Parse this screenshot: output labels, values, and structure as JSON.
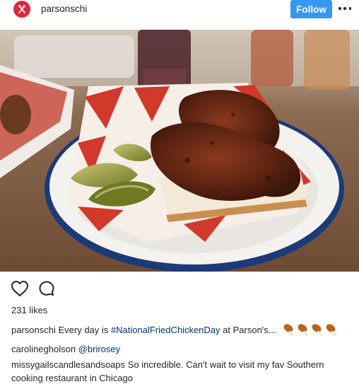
{
  "header": {
    "username": "parsonschi",
    "follow_label": "Follow",
    "avatar_icon": "fork-knife-icon",
    "more_icon": "more-options-icon"
  },
  "photo": {
    "icon": "fried-chicken-photo"
  },
  "actions": {
    "like_icon": "heart-icon",
    "comment_icon": "comment-bubble-icon"
  },
  "likes": "231 likes",
  "caption": {
    "username": "parsonschi",
    "text_before": " Every day is ",
    "hashtag": "#NationalFriedChickenDay",
    "text_after": " at Parson's...",
    "emoji_icon": "drumstick-icon"
  },
  "comments": [
    {
      "username": "carolinegholson",
      "mention": "@brirosey",
      "text": ""
    },
    {
      "username": "missygailscandlesandsoaps",
      "text": " So incredible. Can't wait to visit my fav Southern cooking restaurant in Chicago"
    }
  ],
  "colors": {
    "follow_button": "#3897f0",
    "avatar": "#e0263b",
    "link": "#003569",
    "text": "#262626"
  }
}
